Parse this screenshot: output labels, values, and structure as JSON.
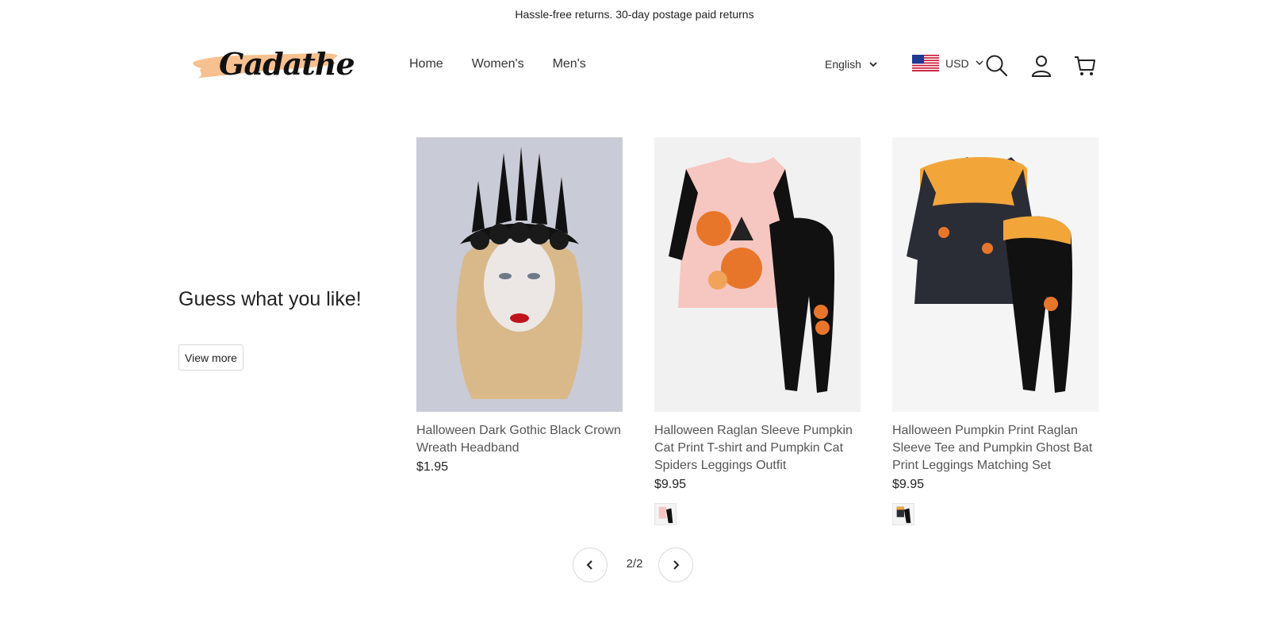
{
  "announcement": "Hassle-free returns. 30-day postage paid returns",
  "brand": {
    "logo_text": "Gadathe",
    "accent_color": "#f7c08f"
  },
  "nav": [
    "Home",
    "Women's",
    "Men's"
  ],
  "language": {
    "label": "English"
  },
  "currency": {
    "label": "USD"
  },
  "icons": [
    "search-icon",
    "account-icon",
    "cart-icon",
    "chevron-down-icon",
    "chevron-left-icon",
    "chevron-right-icon"
  ],
  "section": {
    "title": "Guess what you like!",
    "button": "View more"
  },
  "products": [
    {
      "title": "Halloween Dark Gothic Black Crown Wreath Headband",
      "price": "$1.95"
    },
    {
      "title": "Halloween Raglan Sleeve Pumpkin Cat Print T-shirt and Pumpkin Cat Spiders Leggings Outfit",
      "price": "$9.95"
    },
    {
      "title": "Halloween Pumpkin Print Raglan Sleeve Tee and Pumpkin Ghost Bat Print Leggings Matching Set",
      "price": "$9.95"
    }
  ],
  "pagination": {
    "text": "2/2"
  }
}
